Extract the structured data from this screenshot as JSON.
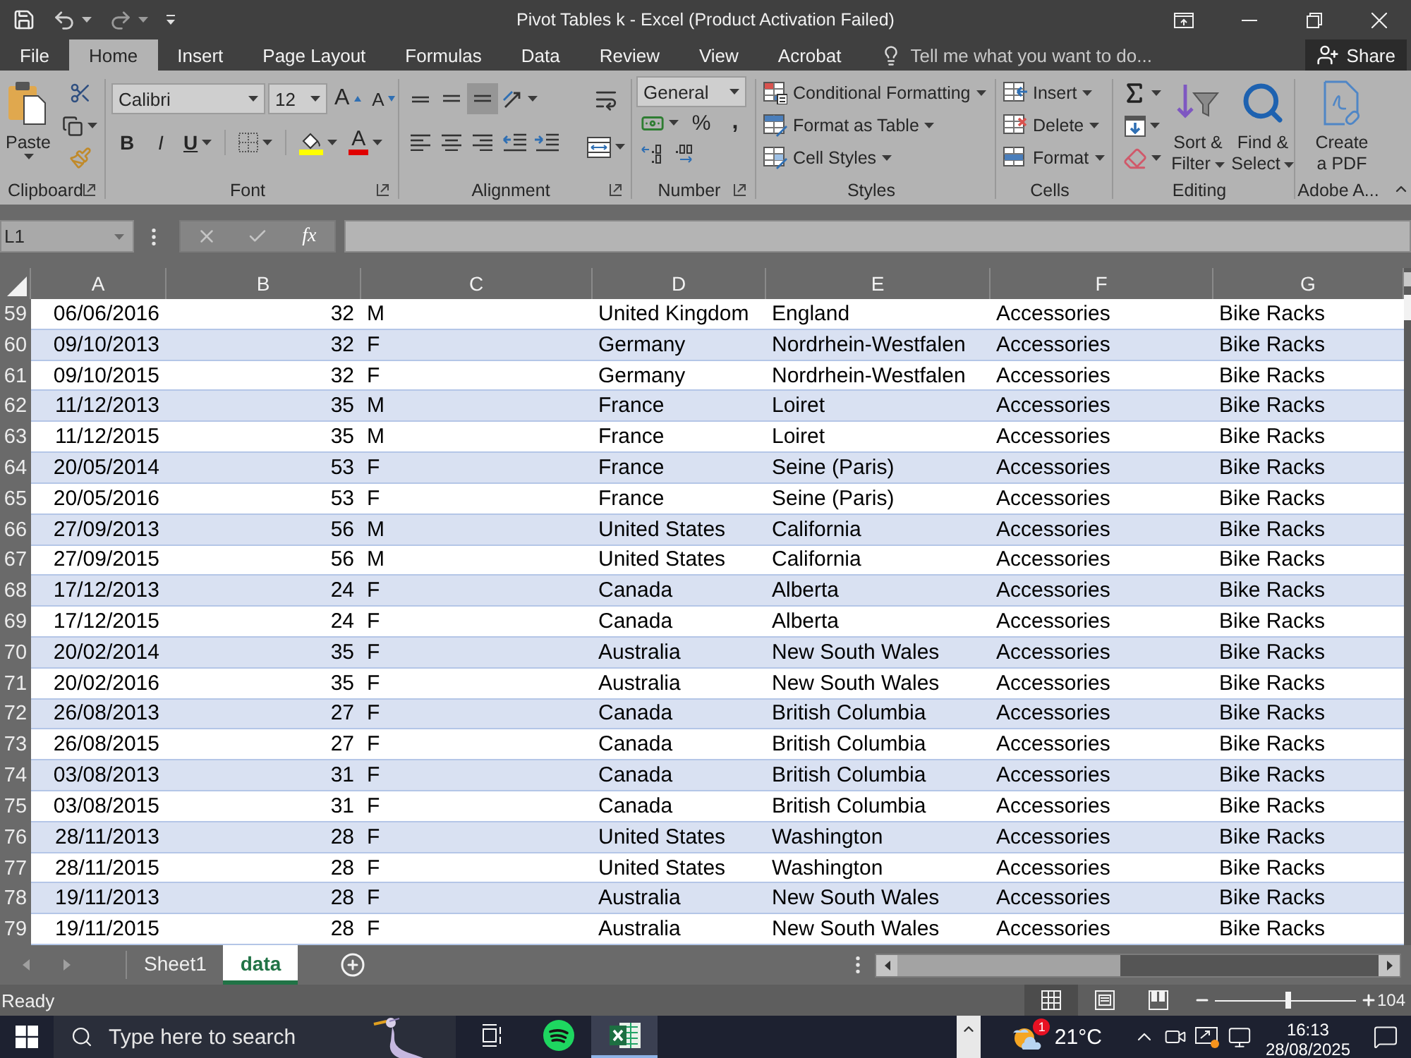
{
  "title_bar": {
    "title": "Pivot Tables k - Excel (Product Activation Failed)"
  },
  "ribbon_tabs": [
    {
      "label": "File",
      "selected": false
    },
    {
      "label": "Home",
      "selected": true
    },
    {
      "label": "Insert",
      "selected": false
    },
    {
      "label": "Page Layout",
      "selected": false
    },
    {
      "label": "Formulas",
      "selected": false
    },
    {
      "label": "Data",
      "selected": false
    },
    {
      "label": "Review",
      "selected": false
    },
    {
      "label": "View",
      "selected": false
    },
    {
      "label": "Acrobat",
      "selected": false
    }
  ],
  "tell_me": {
    "placeholder": "Tell me what you want to do..."
  },
  "share_button": "Share",
  "ribbon": {
    "clipboard": {
      "label": "Clipboard",
      "paste": "Paste"
    },
    "font": {
      "label": "Font",
      "font_name": "Calibri",
      "font_size": "12",
      "grow": "A",
      "shrink": "A",
      "bold": "B",
      "italic": "I",
      "underline": "U",
      "font_color": "A"
    },
    "alignment": {
      "label": "Alignment",
      "vertical_align_buttons": [
        {
          "kind": "top",
          "selected": false
        },
        {
          "kind": "middle",
          "selected": false
        },
        {
          "kind": "bottom",
          "selected": true
        }
      ]
    },
    "number": {
      "label": "Number",
      "format": "General",
      "percent": "%",
      "comma": ","
    },
    "styles": {
      "label": "Styles",
      "buttons": [
        "Conditional Formatting",
        "Format as Table",
        "Cell Styles"
      ]
    },
    "cells": {
      "label": "Cells",
      "buttons": [
        "Insert",
        "Delete",
        "Format"
      ]
    },
    "editing": {
      "label": "Editing",
      "sort_filter": [
        "Sort &",
        "Filter"
      ],
      "find_select": [
        "Find &",
        "Select"
      ]
    },
    "adobe": {
      "label": "Adobe A...",
      "create_pdf": [
        "Create",
        "a PDF"
      ]
    }
  },
  "formula_bar": {
    "name_box": "L1",
    "function_button": "fx"
  },
  "sheet": {
    "columns": [
      "A",
      "B",
      "C",
      "D",
      "E",
      "F",
      "G"
    ],
    "banded_rows": true,
    "rows": [
      {
        "number": "59",
        "cells": [
          "06/06/2016",
          "32",
          "M",
          "United Kingdom",
          "England",
          "Accessories",
          "Bike Racks"
        ]
      },
      {
        "number": "60",
        "cells": [
          "09/10/2013",
          "32",
          "F",
          "Germany",
          "Nordrhein-Westfalen",
          "Accessories",
          "Bike Racks"
        ]
      },
      {
        "number": "61",
        "cells": [
          "09/10/2015",
          "32",
          "F",
          "Germany",
          "Nordrhein-Westfalen",
          "Accessories",
          "Bike Racks"
        ]
      },
      {
        "number": "62",
        "cells": [
          "11/12/2013",
          "35",
          "M",
          "France",
          "Loiret",
          "Accessories",
          "Bike Racks"
        ]
      },
      {
        "number": "63",
        "cells": [
          "11/12/2015",
          "35",
          "M",
          "France",
          "Loiret",
          "Accessories",
          "Bike Racks"
        ]
      },
      {
        "number": "64",
        "cells": [
          "20/05/2014",
          "53",
          "F",
          "France",
          "Seine (Paris)",
          "Accessories",
          "Bike Racks"
        ]
      },
      {
        "number": "65",
        "cells": [
          "20/05/2016",
          "53",
          "F",
          "France",
          "Seine (Paris)",
          "Accessories",
          "Bike Racks"
        ]
      },
      {
        "number": "66",
        "cells": [
          "27/09/2013",
          "56",
          "M",
          "United States",
          "California",
          "Accessories",
          "Bike Racks"
        ]
      },
      {
        "number": "67",
        "cells": [
          "27/09/2015",
          "56",
          "M",
          "United States",
          "California",
          "Accessories",
          "Bike Racks"
        ]
      },
      {
        "number": "68",
        "cells": [
          "17/12/2013",
          "24",
          "F",
          "Canada",
          "Alberta",
          "Accessories",
          "Bike Racks"
        ]
      },
      {
        "number": "69",
        "cells": [
          "17/12/2015",
          "24",
          "F",
          "Canada",
          "Alberta",
          "Accessories",
          "Bike Racks"
        ]
      },
      {
        "number": "70",
        "cells": [
          "20/02/2014",
          "35",
          "F",
          "Australia",
          "New South Wales",
          "Accessories",
          "Bike Racks"
        ]
      },
      {
        "number": "71",
        "cells": [
          "20/02/2016",
          "35",
          "F",
          "Australia",
          "New South Wales",
          "Accessories",
          "Bike Racks"
        ]
      },
      {
        "number": "72",
        "cells": [
          "26/08/2013",
          "27",
          "F",
          "Canada",
          "British Columbia",
          "Accessories",
          "Bike Racks"
        ]
      },
      {
        "number": "73",
        "cells": [
          "26/08/2015",
          "27",
          "F",
          "Canada",
          "British Columbia",
          "Accessories",
          "Bike Racks"
        ]
      },
      {
        "number": "74",
        "cells": [
          "03/08/2013",
          "31",
          "F",
          "Canada",
          "British Columbia",
          "Accessories",
          "Bike Racks"
        ]
      },
      {
        "number": "75",
        "cells": [
          "03/08/2015",
          "31",
          "F",
          "Canada",
          "British Columbia",
          "Accessories",
          "Bike Racks"
        ]
      },
      {
        "number": "76",
        "cells": [
          "28/11/2013",
          "28",
          "F",
          "United States",
          "Washington",
          "Accessories",
          "Bike Racks"
        ]
      },
      {
        "number": "77",
        "cells": [
          "28/11/2015",
          "28",
          "F",
          "United States",
          "Washington",
          "Accessories",
          "Bike Racks"
        ]
      },
      {
        "number": "78",
        "cells": [
          "19/11/2013",
          "28",
          "F",
          "Australia",
          "New South Wales",
          "Accessories",
          "Bike Racks"
        ]
      },
      {
        "number": "79",
        "cells": [
          "19/11/2015",
          "28",
          "F",
          "Australia",
          "New South Wales",
          "Accessories",
          "Bike Racks"
        ]
      }
    ]
  },
  "sheet_tabs": [
    {
      "label": "Sheet1",
      "selected": false
    },
    {
      "label": "data",
      "selected": true
    }
  ],
  "status_bar": {
    "status": "Ready",
    "views": [
      {
        "kind": "normal",
        "selected": true
      },
      {
        "kind": "page_layout",
        "selected": false
      },
      {
        "kind": "page_break",
        "selected": false
      }
    ],
    "zoom": {
      "level": 0.52,
      "reading": "104"
    }
  },
  "taskbar": {
    "search": {
      "placeholder": "Type here to search"
    },
    "apps": [
      {
        "kind": "task_view",
        "selected": false
      },
      {
        "kind": "spotify",
        "selected": false
      },
      {
        "kind": "excel",
        "selected": true
      }
    ],
    "weather": {
      "badge": "1",
      "temperature": "21°C"
    },
    "time": "16:13",
    "date": "28/08/2025"
  }
}
